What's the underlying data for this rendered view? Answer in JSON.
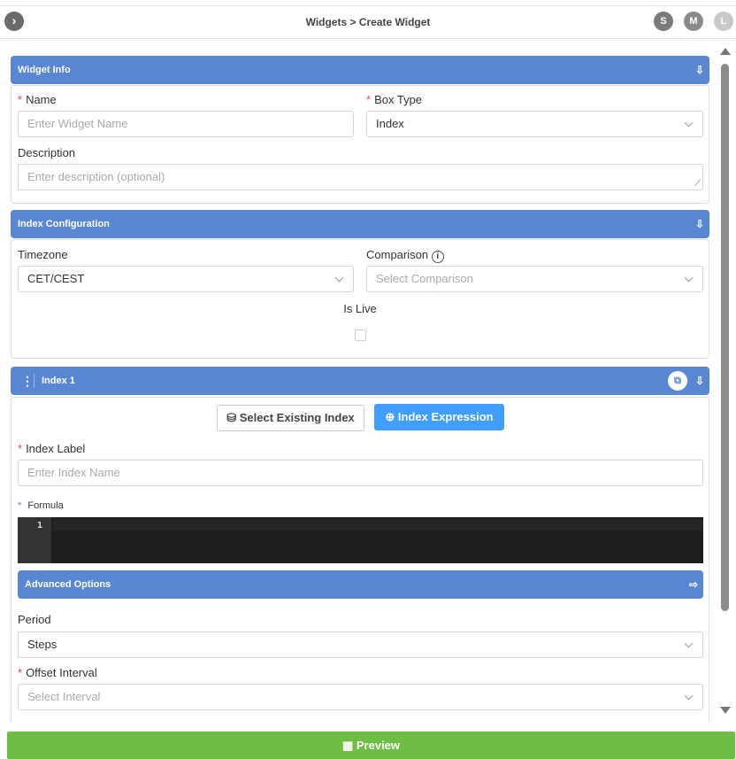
{
  "header": {
    "toggle_icon": "›",
    "breadcrumb": "Widgets > Create Widget",
    "avatars": [
      {
        "letter": "S",
        "color": "#7a7a7a"
      },
      {
        "letter": "M",
        "color": "#8a8a8a"
      },
      {
        "letter": "L",
        "color": "#c9c9c9"
      }
    ]
  },
  "widget_info": {
    "title": "Widget Info",
    "name_label": "Name",
    "name_placeholder": "Enter Widget Name",
    "box_type_label": "Box Type",
    "box_type_value": "Index",
    "description_label": "Description",
    "description_placeholder": "Enter description (optional)"
  },
  "index_config": {
    "title": "Index Configuration",
    "timezone_label": "Timezone",
    "timezone_value": "CET/CEST",
    "comparison_label": "Comparison",
    "comparison_placeholder": "Select Comparison",
    "is_live_label": "Is Live"
  },
  "index1": {
    "title": "Index 1",
    "select_existing_label": "Select Existing Index",
    "index_expression_label": "Index Expression",
    "index_label_label": "Index Label",
    "index_label_placeholder": "Enter Index Name",
    "formula_label": "Formula",
    "editor_line_number": "1",
    "advanced_title": "Advanced Options",
    "period_label": "Period",
    "period_value": "Steps",
    "offset_label": "Offset Interval",
    "offset_placeholder": "Select Interval"
  },
  "footer": {
    "preview_label": "Preview"
  },
  "colors": {
    "section_bar": "#5a87d3",
    "primary_button": "#409eff",
    "preview_button": "#6fbe44",
    "required": "#e5484d"
  }
}
